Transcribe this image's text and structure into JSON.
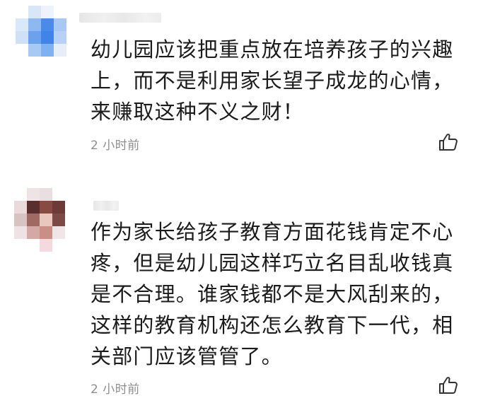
{
  "comments": [
    {
      "text_lines": [
        "幼儿园应该把重点放在培养孩子的兴趣",
        "上，而不是利用家长望子成龙的心情，",
        "来赚取这种不义之财！"
      ],
      "time": "2 小时前",
      "like_icon": "thumbs-up-icon",
      "avatar_colors": [
        "#4a8be8",
        "#a9c9f5",
        "#e7eef9",
        "#8fb8f0",
        "#cfe0f7"
      ]
    },
    {
      "text_lines": [
        "作为家长给孩子教育方面花钱肯定不心",
        "疼，但是幼儿园这样巧立名目乱收钱真",
        "是不合理。谁家钱都不是大风刮来的，",
        "这样的教育机构还怎么教育下一代，相",
        "关部门应该管管了。"
      ],
      "time": "2 小时前",
      "like_icon": "thumbs-up-icon",
      "avatar_colors": [
        "#5b2e2e",
        "#c98f86",
        "#e9c7bf",
        "#d4a9a5",
        "#f4d9de"
      ]
    }
  ]
}
